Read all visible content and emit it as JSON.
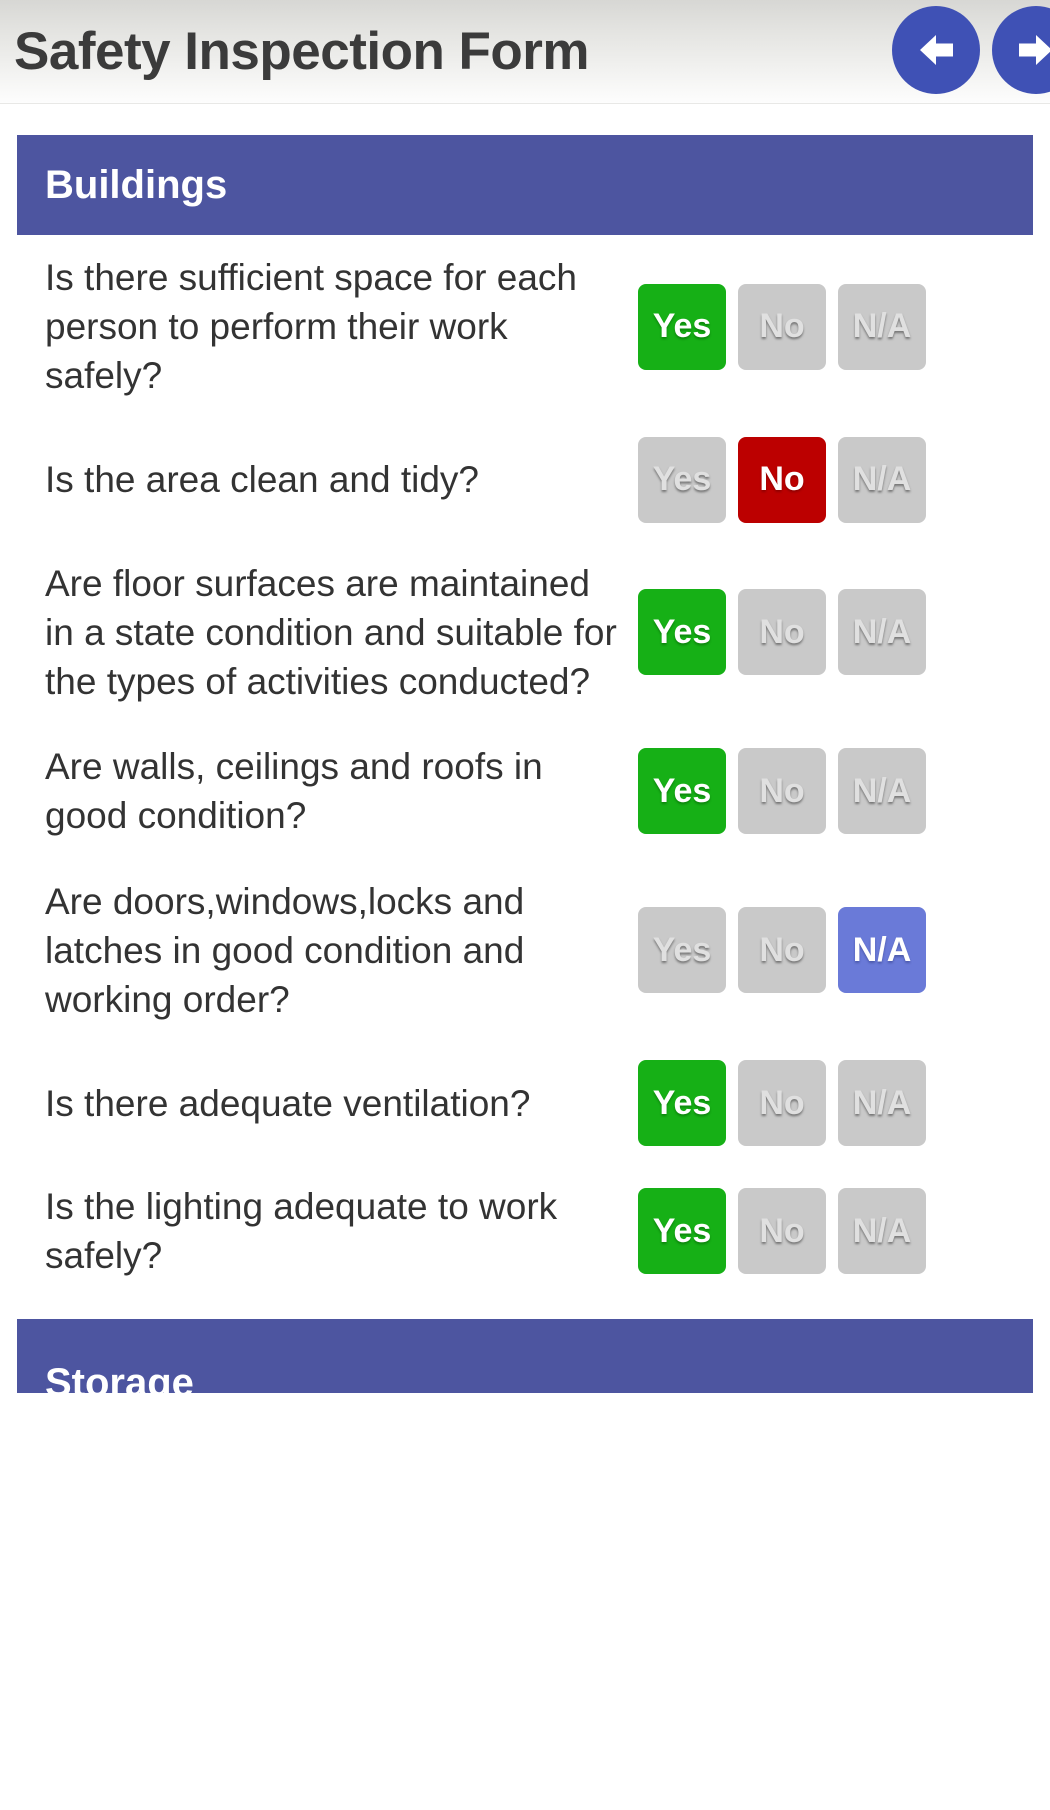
{
  "app": {
    "title": "Safety Inspection Form"
  },
  "nav": {
    "back_label": "Previous page",
    "back_icon": "arrow-left-icon",
    "forward_label": "Next page",
    "forward_icon": "arrow-right-icon"
  },
  "answer_labels": {
    "yes": "Yes",
    "no": "No",
    "na": "N/A"
  },
  "colors": {
    "section_band": "#4d55a0",
    "yes_selected": "#16b016",
    "no_selected": "#bc0000",
    "na_selected": "#6a7ad8",
    "unselected": "#c9c9c9",
    "nav_button": "#3f51b5",
    "question_text": "#333333"
  },
  "sections": [
    {
      "id": "buildings",
      "title": "Buildings",
      "questions": [
        {
          "text": "Is there sufficient space for each person to perform their work safely?",
          "selected": "yes"
        },
        {
          "text": "Is the area clean and tidy?",
          "selected": "no"
        },
        {
          "text": "Are floor surfaces are maintained in a state condition and suitable for the types of activities conducted?",
          "selected": "yes"
        },
        {
          "text": "Are walls, ceilings and roofs in good condition?",
          "selected": "yes"
        },
        {
          "text": "Are doors,windows,locks and latches in good condition and working order?",
          "selected": "na"
        },
        {
          "text": "Is there adequate ventilation?",
          "selected": "yes"
        },
        {
          "text": "Is the lighting adequate to work safely?",
          "selected": "yes"
        }
      ]
    },
    {
      "id": "storage",
      "title": "Storage",
      "questions": []
    }
  ]
}
